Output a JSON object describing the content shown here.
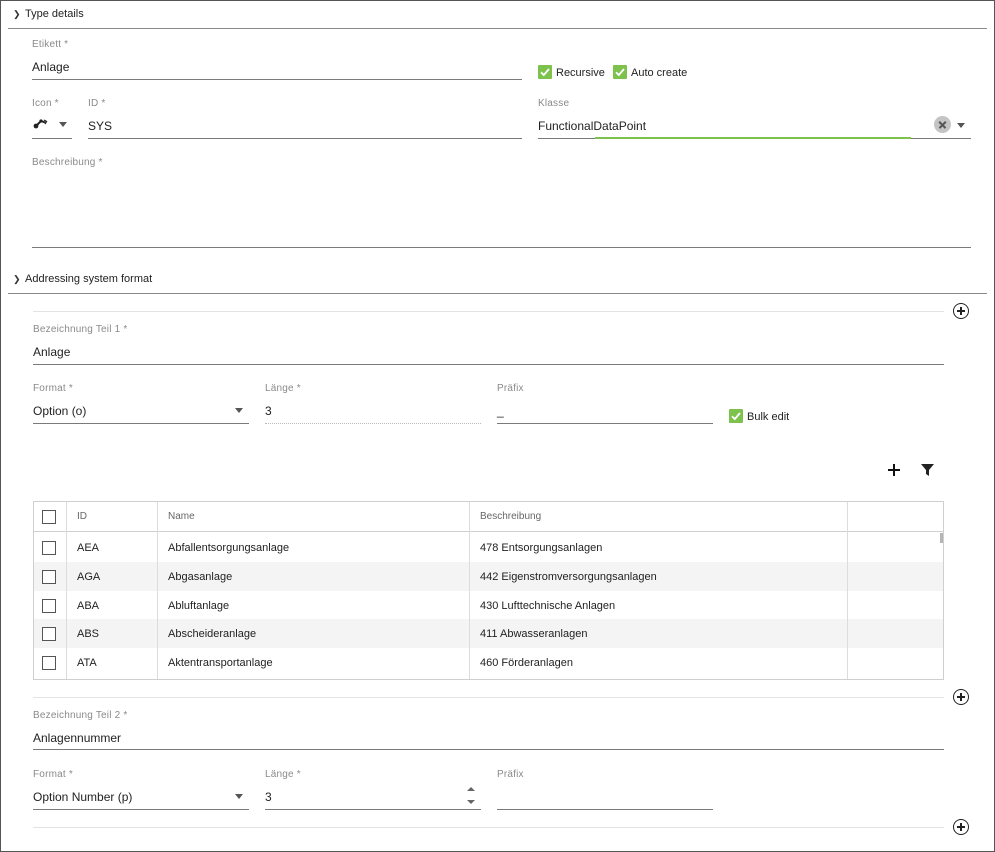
{
  "type_details": {
    "header": "Type details",
    "etikett": {
      "label": "Etikett *",
      "value": "Anlage"
    },
    "recursive": {
      "label": "Recursive",
      "checked": true
    },
    "auto_create": {
      "label": "Auto create",
      "checked": true
    },
    "icon": {
      "label": "Icon *",
      "icon": "robot-arm-icon"
    },
    "id": {
      "label": "ID *",
      "value": "SYS"
    },
    "klasse": {
      "label": "Klasse",
      "value": "FunctionalDataPoint"
    },
    "beschreibung": {
      "label": "Beschreibung *",
      "value": ""
    }
  },
  "addressing": {
    "header": "Addressing system format",
    "part1": {
      "name_label": "Bezeichnung Teil 1 *",
      "name_value": "Anlage",
      "format_label": "Format *",
      "format_value": "Option (o)",
      "laenge_label": "Länge *",
      "laenge_value": "3",
      "praefix_label": "Präfix",
      "praefix_value": "_",
      "bulk_edit": {
        "label": "Bulk edit",
        "checked": true
      },
      "table": {
        "columns": [
          "ID",
          "Name",
          "Beschreibung"
        ],
        "rows": [
          {
            "id": "AEA",
            "name": "Abfallentsorgungsanlage",
            "beschreibung": "478 Entsorgungsanlagen"
          },
          {
            "id": "AGA",
            "name": "Abgasanlage",
            "beschreibung": "442 Eigenstromversorgungsanlagen"
          },
          {
            "id": "ABA",
            "name": "Abluftanlage",
            "beschreibung": "430 Lufttechnische Anlagen"
          },
          {
            "id": "ABS",
            "name": "Abscheideranlage",
            "beschreibung": "411 Abwasseranlagen"
          },
          {
            "id": "ATA",
            "name": "Aktentransportanlage",
            "beschreibung": "460 Förderanlagen"
          }
        ]
      }
    },
    "part2": {
      "name_label": "Bezeichnung Teil 2 *",
      "name_value": "Anlagennummer",
      "format_label": "Format *",
      "format_value": "Option Number (p)",
      "laenge_label": "Länge *",
      "laenge_value": "3",
      "praefix_label": "Präfix",
      "praefix_value": ""
    }
  },
  "colors": {
    "accent_green": "#7cc24c",
    "row_alt": "#f4f4f4"
  }
}
